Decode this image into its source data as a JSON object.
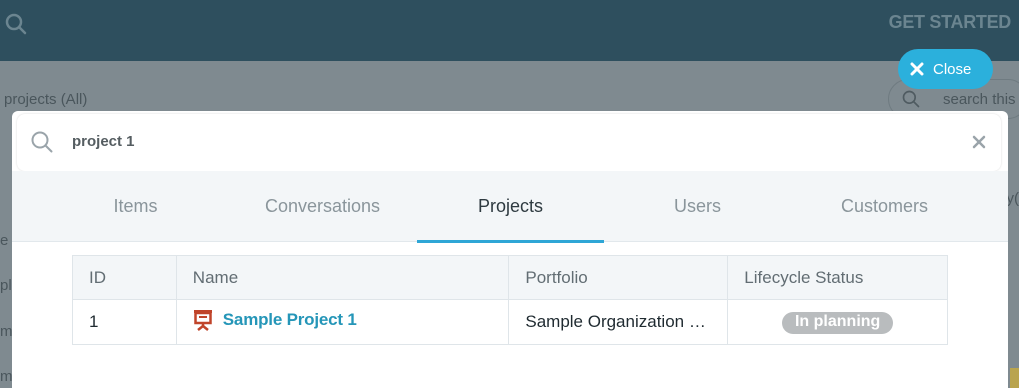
{
  "header": {
    "get_started": "GET STARTED"
  },
  "background": {
    "projects_label": "projects (All)",
    "search_placeholder": "search this",
    "left_fragments": [
      "e C",
      "ple",
      "mp",
      "mp"
    ],
    "right_fragment": "y("
  },
  "close_button": {
    "label": "Close"
  },
  "search": {
    "query": "project 1"
  },
  "tabs": [
    {
      "label": "Items",
      "active": false
    },
    {
      "label": "Conversations",
      "active": false
    },
    {
      "label": "Projects",
      "active": true
    },
    {
      "label": "Users",
      "active": false
    },
    {
      "label": "Customers",
      "active": false
    }
  ],
  "table": {
    "columns": [
      "ID",
      "Name",
      "Portfolio",
      "Lifecycle Status"
    ],
    "rows": [
      {
        "id": "1",
        "name": "Sample Project 1",
        "portfolio": "Sample Organization …",
        "status": "In planning"
      }
    ]
  },
  "colors": {
    "accent": "#2bb0dc",
    "link": "#2596b8",
    "status_badge": "#b9bcbe",
    "project_icon": "#c0442a"
  },
  "icons": {
    "search": "search-icon",
    "close": "close-icon",
    "clear": "clear-icon",
    "project": "project-presentation-icon"
  }
}
